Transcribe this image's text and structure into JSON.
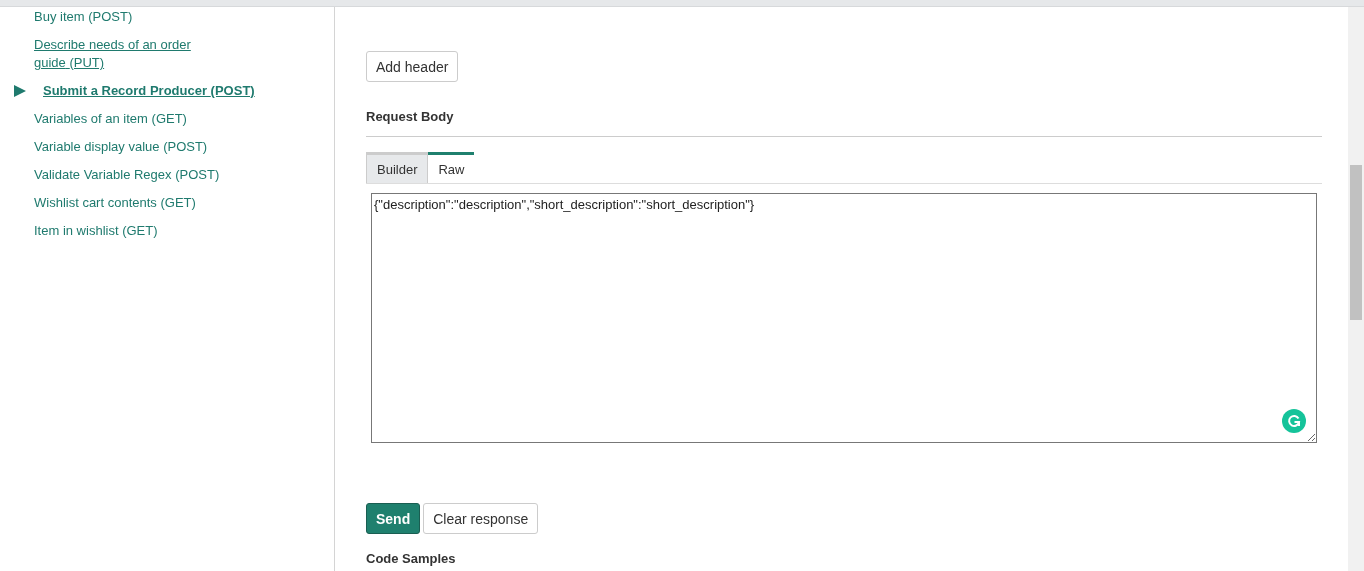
{
  "sidebar": {
    "items": [
      {
        "name": "Buy item",
        "method": "(POST)",
        "selected": false,
        "underlined": false
      },
      {
        "name": "Describe needs of an order guide",
        "method": "(PUT)",
        "selected": false,
        "underlined": true
      },
      {
        "name": "Submit a Record Producer",
        "method": "(POST)",
        "selected": true,
        "underlined": true
      },
      {
        "name": "Variables of an item",
        "method": "(GET)",
        "selected": false,
        "underlined": false
      },
      {
        "name": "Variable display value ",
        "method": "(POST)",
        "selected": false,
        "underlined": false
      },
      {
        "name": "Validate Variable Regex",
        "method": "(POST)",
        "selected": false,
        "underlined": false
      },
      {
        "name": "Wishlist cart contents",
        "method": "(GET)",
        "selected": false,
        "underlined": false
      },
      {
        "name": "Item in wishlist",
        "method": "(GET)",
        "selected": false,
        "underlined": false
      }
    ]
  },
  "main": {
    "add_header_button": "Add header",
    "request_body_title": "Request Body",
    "tabs": [
      {
        "label": "Builder",
        "selected": false
      },
      {
        "label": "Raw",
        "selected": true
      }
    ],
    "body_value": "{\"description\":\"description\",\"short_description\":\"short_description\"}",
    "send_button": "Send",
    "clear_button": "Clear response",
    "code_samples_title": "Code Samples"
  }
}
